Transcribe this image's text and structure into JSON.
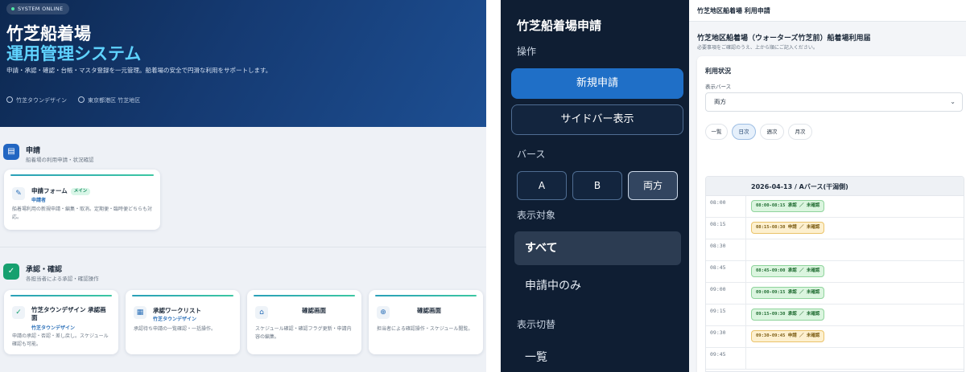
{
  "left": {
    "hero": {
      "badge": "SYSTEM ONLINE",
      "title1": "竹芝船着場",
      "title2": "運用管理システム",
      "description": "申請・承認・確認・台帳・マスタ登録を一元管理。船着場の安全で円滑な利用をサポートします。",
      "meta1": "竹芝タウンデザイン",
      "meta2": "東京都港区 竹芝地区"
    },
    "section1": {
      "title": "申請",
      "subtitle": "船着場の利用申請・状況確認",
      "card": {
        "title": "申請フォーム",
        "tag": "メイン",
        "role": "申請者",
        "desc": "船着場利用の新規申請・編集・取消。定期便・臨時便どちらも対応。"
      }
    },
    "section2": {
      "title": "承認・確認",
      "subtitle": "各担当者による承認・確認操作",
      "cards": [
        {
          "title": "竹芝タウンデザイン 承認画面",
          "role": "竹芝タウンデザイン",
          "desc": "申請の承認・否認・差し戻し。スケジュール確認も可能。"
        },
        {
          "title": "承認ワークリスト",
          "role": "竹芝タウンデザイン",
          "desc": "承認待ち申請の一覧確認・一括操作。"
        },
        {
          "title": "確認画面",
          "role": "",
          "desc": "スケジュール確認・確認フラグ更新・申請内容の編集。"
        },
        {
          "title": "確認画面",
          "role": "",
          "desc": "担当者による確認操作・スケジュール閲覧。"
        }
      ]
    }
  },
  "sidebar": {
    "title": "竹芝船着場申請",
    "section_ops": "操作",
    "btn_new": "新規申請",
    "btn_sidebar": "サイドバー表示",
    "section_berth": "バース",
    "berths": [
      "A",
      "B",
      "両方"
    ],
    "active_berth": "両方",
    "section_target": "表示対象",
    "targets": [
      "すべて",
      "申請中のみ"
    ],
    "section_switch": "表示切替",
    "switch_list": "一覧"
  },
  "form": {
    "topbar": "竹芝地区船着場 利用申請",
    "title": "竹芝地区船着場（ウォーターズ竹芝前）船着場利用届",
    "note": "必要事項をご確認のうえ、上から順にご記入ください。",
    "heading": "利用状況",
    "berth_label": "表示バース",
    "berth_value": "両方",
    "views": [
      "一覧",
      "日次",
      "週次",
      "月次"
    ],
    "active_view": "日次",
    "schedule_header": "2026-04-13 / Aバース(干潟側)",
    "rows": [
      {
        "time": "08:00",
        "chip": "08:00-08:15 承認 ／ 未確認",
        "status": "ok"
      },
      {
        "time": "08:15",
        "chip": "08:15-08:30 申請 ／ 未確認",
        "status": "req"
      },
      {
        "time": "08:30",
        "chip": "",
        "status": ""
      },
      {
        "time": "08:45",
        "chip": "08:45-09:00 承認 ／ 未確認",
        "status": "ok"
      },
      {
        "time": "09:00",
        "chip": "09:00-09:15 承認 ／ 未確認",
        "status": "ok"
      },
      {
        "time": "09:15",
        "chip": "09:15-09:30 承認 ／ 未確認",
        "status": "ok"
      },
      {
        "time": "09:30",
        "chip": "09:30-09:45 申請 ／ 未確認",
        "status": "req"
      },
      {
        "time": "09:45",
        "chip": "",
        "status": ""
      }
    ]
  },
  "colors": {
    "hero_start": "#0d2850",
    "hero_accent": "#5fd3ff",
    "sidebar_bg": "#0f1e33",
    "primary": "#1f6fc7",
    "ok": "#dbf5df",
    "req": "#fdf0cf"
  }
}
